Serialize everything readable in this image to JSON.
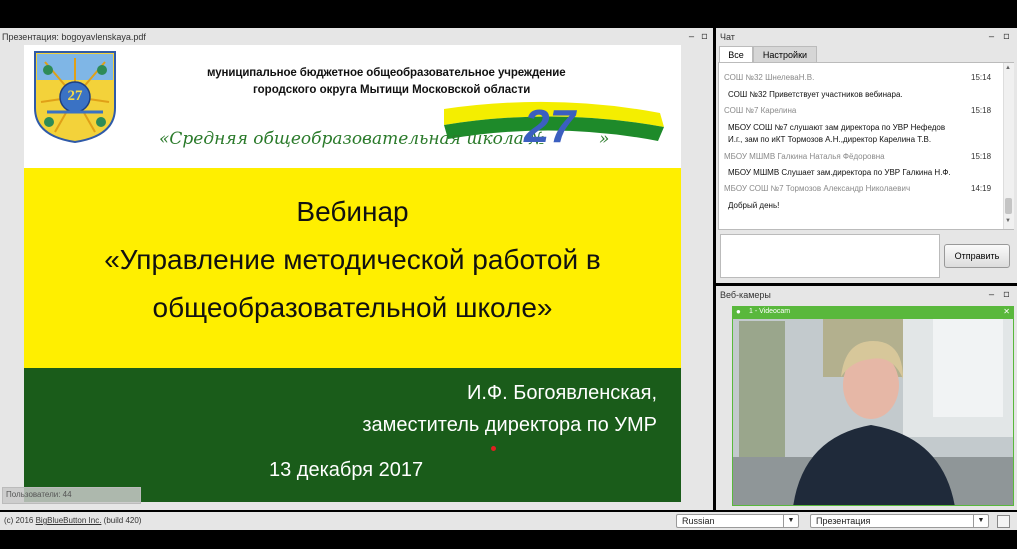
{
  "presentation": {
    "title": "Презентация: bogoyavlenskaya.pdf",
    "users_label": "Пользователи: 44",
    "slide": {
      "crest_number": "27",
      "header_line1": "муниципальное бюджетное общеобразовательное учреждение",
      "header_line2": "городского округа Мытищи Московской области",
      "school_name": "«Средняя общеобразовательная школа №",
      "school_number": "27",
      "school_close_quote": "»",
      "title_line1": "Вебинар",
      "title_line2": "«Управление методической работой в",
      "title_line3": "общеобразовательной школе»",
      "author": "И.Ф. Богоявленская,",
      "position": "заместитель директора по УМР",
      "date": "13 декабря 2017"
    }
  },
  "chat": {
    "title": "Чат",
    "tabs": [
      "Все",
      "Настройки"
    ],
    "messages": [
      {
        "name": "СОШ №32 ШнелеваН.В.",
        "time": "15:14",
        "text": [
          "СОШ №32 Приветствует участников вебинара."
        ]
      },
      {
        "name": "СОШ №7 Карелина",
        "time": "15:18",
        "text": [
          "МБОУ СОШ №7 слушают зам директора по УВР Нефедов",
          "И.г., зам по иКТ Тормозов А.Н.,директор Карелина Т.В."
        ]
      },
      {
        "name": "МБОУ МШМВ Галкина Наталья Фёдоровна",
        "time": "15:18",
        "text": [
          "МБОУ МШМВ Слушает зам.директора по УВР Галкина Н.Ф."
        ]
      },
      {
        "name": "МБОУ СОШ №7 Тормозов Александр Николаевич",
        "time": "14:19",
        "text": [
          "Добрый день!"
        ]
      }
    ],
    "send_label": "Отправить"
  },
  "webcams": {
    "title": "Веб-камеры",
    "video_label": "1 - Videocam"
  },
  "footer": {
    "copyright": "(c) 2016",
    "copyright_link": "BigBlueButton Inc.",
    "build": "(build 420)",
    "language": "Russian",
    "layout": "Презентация"
  },
  "colors": {
    "slide_yellow": "#ffef00",
    "slide_green": "#1a5c1a",
    "school_blue": "#3b5fc0",
    "webcam_green": "#59b83c"
  },
  "icons": {
    "minimize": "minimize-icon",
    "maximize": "maximize-icon",
    "dropdown": "chevron-down-icon",
    "user": "user-icon",
    "close": "close-icon",
    "layout": "layout-icon"
  }
}
